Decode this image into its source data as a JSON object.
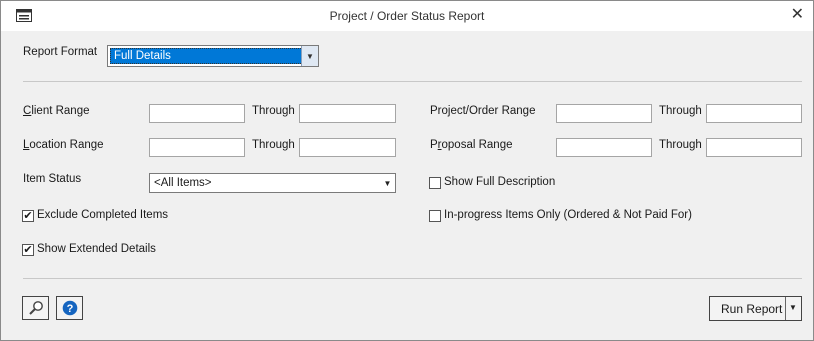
{
  "window": {
    "title": "Project / Order Status Report"
  },
  "report_format": {
    "label": "Report Format",
    "value": "Full Details"
  },
  "fields": {
    "client_range": {
      "label_prefix": "",
      "label_ul": "C",
      "label_rest": "lient Range",
      "through": "Through",
      "from": "",
      "to": ""
    },
    "location_range": {
      "label_ul": "L",
      "label_rest": "ocation Range",
      "through": "Through",
      "from": "",
      "to": ""
    },
    "project_order_range": {
      "label": "Project/Order Range",
      "through": "Through",
      "from": "",
      "to": ""
    },
    "proposal_range": {
      "label_pre": "P",
      "label_ul": "r",
      "label_rest": "oposal Range",
      "through": "Through",
      "from": "",
      "to": ""
    }
  },
  "item_status": {
    "label": "Item Status",
    "value": "<All Items>"
  },
  "checkboxes": {
    "show_full_description": {
      "label": "Show Full Description",
      "checked": false
    },
    "exclude_completed": {
      "label": "Exclude Completed Items",
      "checked": true
    },
    "in_progress_only": {
      "label": "In-progress Items Only (Ordered & Not Paid For)",
      "checked": false
    },
    "show_extended": {
      "label": "Show Extended Details",
      "checked": true
    }
  },
  "buttons": {
    "run_report": "Run Report"
  },
  "colors": {
    "highlight": "#0078d7",
    "help_icon": "#1565c0"
  },
  "check_mark": "✔"
}
